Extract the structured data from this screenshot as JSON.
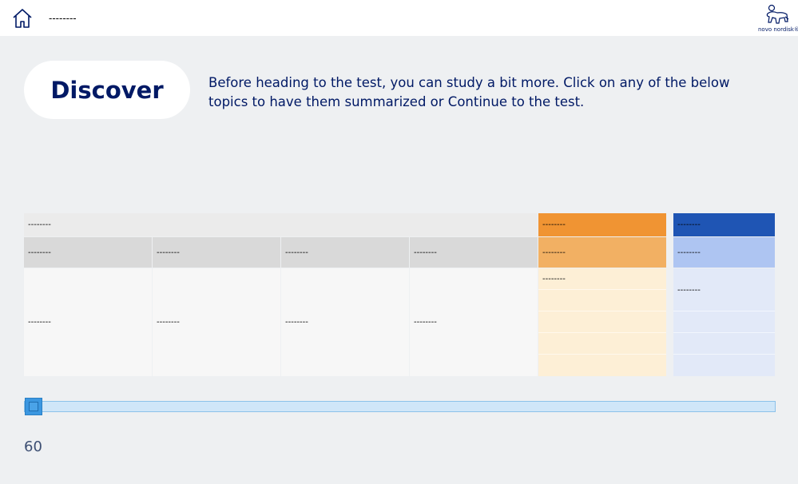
{
  "header": {
    "home_label": "--------",
    "logo_text": "novo nordisk®"
  },
  "intro": {
    "title": "Discover",
    "text": "Before heading to the test, you can study a bit more. Click on any of the below topics to have them summarized or Continue to the test."
  },
  "table": {
    "main_group_header": "--------",
    "orange_group_header": "--------",
    "blue_group_header": "--------",
    "column_headers": [
      "--------",
      "--------",
      "--------",
      "--------"
    ],
    "orange_column_header": "--------",
    "blue_column_header": "--------",
    "row_values": [
      "--------",
      "--------",
      "--------",
      "--------"
    ],
    "orange_row_value": "--------",
    "blue_row_value": "--------"
  },
  "colors": {
    "navy": "#001965",
    "orange_header": "#f09433",
    "orange_subheader": "#f2b063",
    "orange_body": "#fdefd6",
    "blue_header": "#1f55b4",
    "blue_subheader": "#aec5f2",
    "blue_body": "#e2e9f8"
  },
  "footer": {
    "page_number": "60",
    "scroll_position": 0
  }
}
